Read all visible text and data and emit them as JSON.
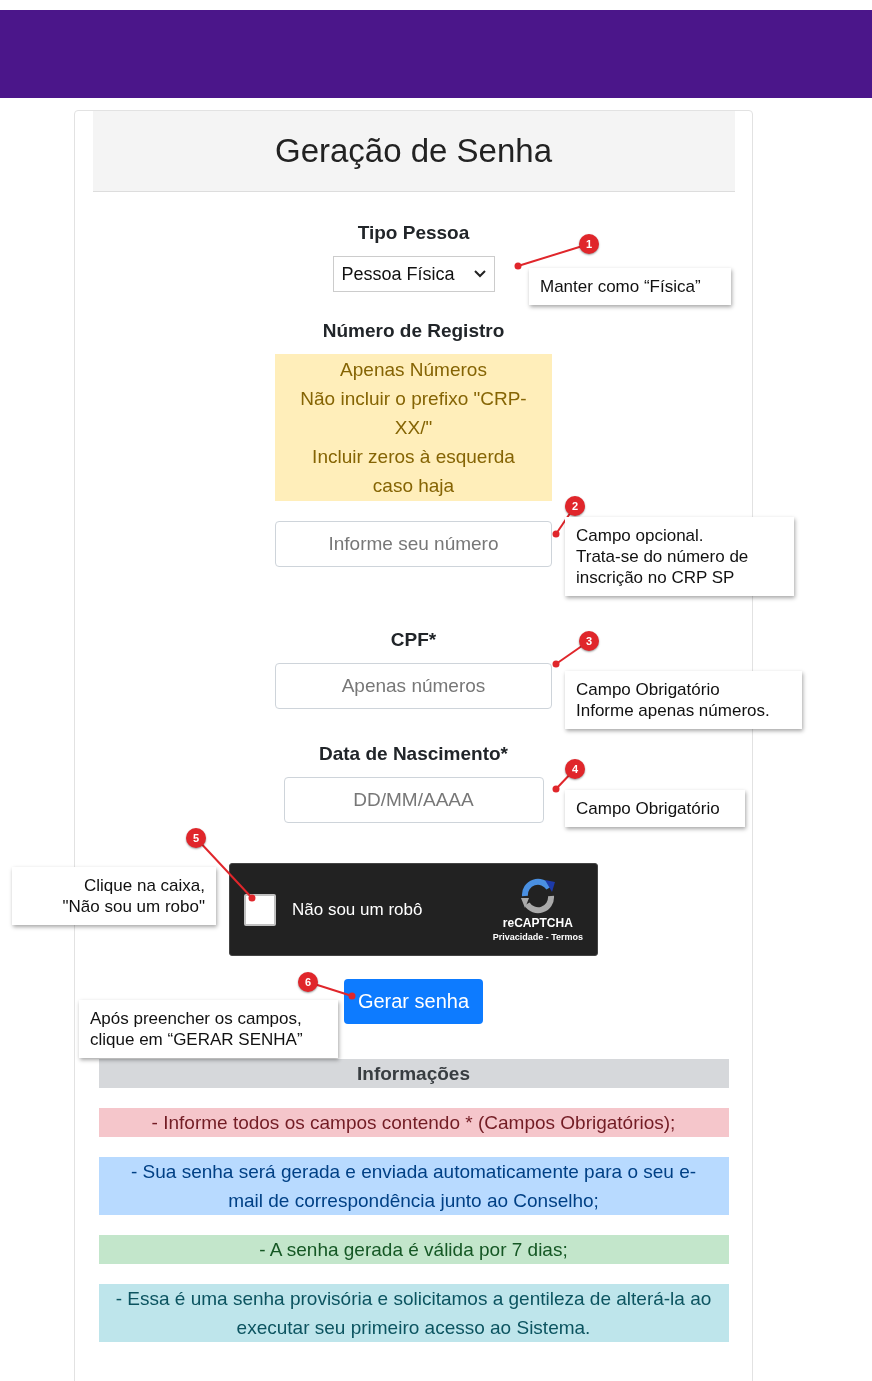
{
  "header": {
    "title": "Geração de Senha"
  },
  "form": {
    "person_type": {
      "label": "Tipo Pessoa",
      "value": "Pessoa Física"
    },
    "registration": {
      "label": "Número de Registro",
      "hints": [
        "Apenas Números",
        "Não incluir o prefixo \"CRP-XX/\"",
        "Incluir zeros à esquerda caso haja"
      ],
      "placeholder": "Informe seu número"
    },
    "cpf": {
      "label": "CPF*",
      "placeholder": "Apenas números"
    },
    "birth_date": {
      "label": "Data de Nascimento*",
      "placeholder": "DD/MM/AAAA"
    },
    "captcha": {
      "label": "Não sou um robô",
      "checked": false,
      "brand": "reCAPTCHA",
      "privacy": "Privacidade - Termos"
    },
    "submit": "Gerar senha"
  },
  "info": {
    "title": "Informações",
    "items": [
      {
        "kind": "danger",
        "text": "- Informe todos os campos contendo * (Campos Obrigatórios);"
      },
      {
        "kind": "primary",
        "text": "- Sua senha será gerada e enviada automaticamente para o seu e-mail de correspondência junto ao Conselho;"
      },
      {
        "kind": "success",
        "text": "- A senha gerada é válida por 7 dias;"
      },
      {
        "kind": "info",
        "text": "- Essa é uma senha provisória e solicitamos a gentileza de alterá-la ao executar seu primeiro acesso ao Sistema."
      }
    ]
  },
  "annotations": [
    {
      "number": "1",
      "lines": [
        "Manter como “Física”"
      ]
    },
    {
      "number": "2",
      "lines": [
        "Campo opcional.",
        "Trata-se do número de",
        "inscrição no CRP SP"
      ]
    },
    {
      "number": "3",
      "lines": [
        "Campo Obrigatório",
        "Informe apenas números."
      ]
    },
    {
      "number": "4",
      "lines": [
        "Campo Obrigatório"
      ]
    },
    {
      "number": "5",
      "lines": [
        "Clique na caixa,",
        "\"Não sou um robo\""
      ]
    },
    {
      "number": "6",
      "lines": [
        "Após preencher os campos,",
        "clique em “GERAR SENHA”"
      ]
    }
  ]
}
